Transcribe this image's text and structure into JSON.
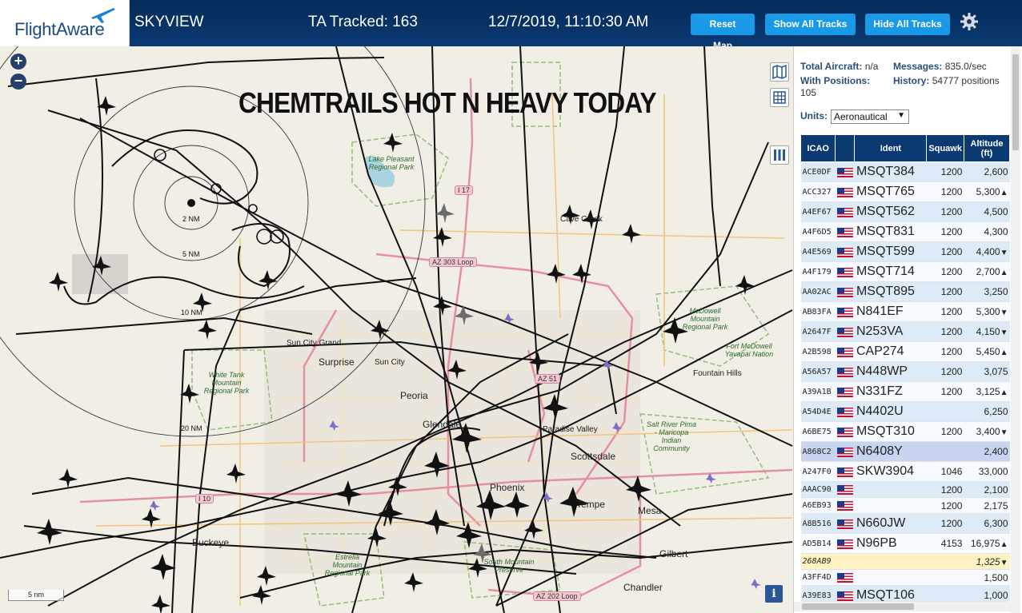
{
  "header": {
    "logo": "FlightAware",
    "app_title": "SKYVIEW",
    "ta_tracked": "TA Tracked: 163",
    "clock": "12/7/2019, 11:10:30 AM",
    "reset_label": "Reset Map",
    "show_label": "Show All Tracks",
    "hide_label": "Hide All Tracks",
    "settings_icon": "gear-icon"
  },
  "map": {
    "overlay_text": "CHEMTRAILS HOT N HEAVY TODAY",
    "zoom_in": "+",
    "zoom_out": "−",
    "info": "i",
    "scale": "5 nm",
    "ring_labels": [
      "2 NM",
      "5 NM",
      "10 NM",
      "20 NM"
    ],
    "places": [
      "Sun City Grand",
      "Surprise",
      "Sun City",
      "Peoria",
      "Glendale",
      "Paradise Valley",
      "Scottsdale",
      "Phoenix",
      "Tempe",
      "Mesa",
      "Gilbert",
      "Chandler",
      "Buckeye",
      "Fountain Hills",
      "Cave Creek"
    ],
    "parks": [
      "Lake Pleasant Regional Park",
      "McDowell Mountain Regional Park",
      "Fort McDowell Yavapai Nation",
      "White Tank Mountain Regional Park",
      "Salt River Pima - Maricopa Indian Community",
      "Estrella Mountain Regional Park",
      "South Mountain Preserve"
    ],
    "shields": [
      "I 17",
      "AZ 303 Loop",
      "AZ 51",
      "I 10",
      "AZ 202 Loop"
    ],
    "colors": {
      "land": "#f1eee6",
      "track": "#111111",
      "road_major": "#e58fa2",
      "road_minor": "#f3c47a",
      "park_border": "#8fbf7a"
    }
  },
  "panel": {
    "total_label": "Total Aircraft:",
    "total_value": "n/a",
    "messages_label": "Messages:",
    "messages_value": "835.0/sec",
    "positions_label": "With Positions:",
    "positions_value": "105",
    "history_label": "History:",
    "history_value": "54777 positions",
    "units_label": "Units:",
    "units_value": "Aeronautical",
    "columns": [
      "ICAO",
      "",
      "Ident",
      "Squawk",
      "Altitude (ft)"
    ],
    "rows": [
      {
        "icao": "ACE0DF",
        "ident": "MSQT384",
        "squawk": "1200",
        "alt": "2,600",
        "trend": ""
      },
      {
        "icao": "ACC327",
        "ident": "MSQT765",
        "squawk": "1200",
        "alt": "5,300",
        "trend": "▲"
      },
      {
        "icao": "A4EF67",
        "ident": "MSQT562",
        "squawk": "1200",
        "alt": "4,500",
        "trend": ""
      },
      {
        "icao": "A4F6D5",
        "ident": "MSQT831",
        "squawk": "1200",
        "alt": "4,300",
        "trend": ""
      },
      {
        "icao": "A4E569",
        "ident": "MSQT599",
        "squawk": "1200",
        "alt": "4,400",
        "trend": "▼"
      },
      {
        "icao": "A4F179",
        "ident": "MSQT714",
        "squawk": "1200",
        "alt": "2,700",
        "trend": "▲"
      },
      {
        "icao": "AA02AC",
        "ident": "MSQT895",
        "squawk": "1200",
        "alt": "3,250",
        "trend": ""
      },
      {
        "icao": "AB83FA",
        "ident": "N841EF",
        "squawk": "1200",
        "alt": "5,300",
        "trend": "▼"
      },
      {
        "icao": "A2647F",
        "ident": "N253VA",
        "squawk": "1200",
        "alt": "4,150",
        "trend": "▼"
      },
      {
        "icao": "A2B598",
        "ident": "CAP274",
        "squawk": "1200",
        "alt": "5,450",
        "trend": "▲"
      },
      {
        "icao": "A56A57",
        "ident": "N448WP",
        "squawk": "1200",
        "alt": "3,075",
        "trend": ""
      },
      {
        "icao": "A39A1B",
        "ident": "N331FZ",
        "squawk": "1200",
        "alt": "3,125",
        "trend": "▲"
      },
      {
        "icao": "A54D4E",
        "ident": "N4402U",
        "squawk": "",
        "alt": "6,250",
        "trend": ""
      },
      {
        "icao": "A6BE75",
        "ident": "MSQT310",
        "squawk": "1200",
        "alt": "3,400",
        "trend": "▼"
      },
      {
        "icao": "A868C2",
        "ident": "N6408Y",
        "squawk": "",
        "alt": "2,400",
        "trend": "",
        "state": "sel"
      },
      {
        "icao": "A247F0",
        "ident": "SKW3904",
        "squawk": "1046",
        "alt": "33,000",
        "trend": ""
      },
      {
        "icao": "AAAC90",
        "ident": "",
        "squawk": "1200",
        "alt": "2,100",
        "trend": "",
        "state": "short"
      },
      {
        "icao": "A6EB93",
        "ident": "",
        "squawk": "1200",
        "alt": "2,175",
        "trend": "",
        "state": "short"
      },
      {
        "icao": "A8B516",
        "ident": "N660JW",
        "squawk": "1200",
        "alt": "6,300",
        "trend": ""
      },
      {
        "icao": "AD5B14",
        "ident": "N96PB",
        "squawk": "4153",
        "alt": "16,975",
        "trend": "▲"
      },
      {
        "icao": "268AB9",
        "ident": "",
        "squawk": "",
        "alt": "1,325",
        "trend": "▼",
        "state": "warn short",
        "noflag": true
      },
      {
        "icao": "A3FF4D",
        "ident": "",
        "squawk": "",
        "alt": "1,500",
        "trend": "",
        "state": "short"
      },
      {
        "icao": "A39E83",
        "ident": "MSQT106",
        "squawk": "",
        "alt": "1,000",
        "trend": ""
      }
    ]
  }
}
